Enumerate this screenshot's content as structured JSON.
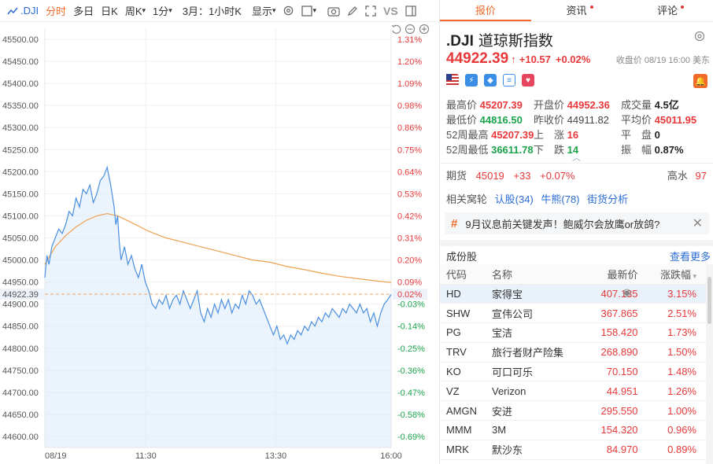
{
  "toolbar": {
    "symbol": ".DJI",
    "items": [
      "分时",
      "多日",
      "日K",
      "周K",
      "1分",
      "3月：1小时K",
      "显示"
    ],
    "vs": "VS"
  },
  "chart_data": {
    "type": "line",
    "y_labels": [
      "45500.00",
      "45450.00",
      "45400.00",
      "45350.00",
      "45300.00",
      "45250.00",
      "45200.00",
      "45150.00",
      "45100.00",
      "45050.00",
      "45000.00",
      "44950.00",
      "44900.00",
      "44850.00",
      "44800.00",
      "44750.00",
      "44700.00",
      "44650.00",
      "44600.00"
    ],
    "y_values": [
      45500,
      45450,
      45400,
      45350,
      45300,
      45250,
      45200,
      45150,
      45100,
      45050,
      45000,
      44950,
      44900,
      44850,
      44800,
      44750,
      44700,
      44650,
      44600
    ],
    "pct_labels": [
      "1.31%",
      "1.20%",
      "1.09%",
      "0.98%",
      "0.86%",
      "0.75%",
      "0.64%",
      "0.53%",
      "0.42%",
      "0.31%",
      "0.20%",
      "0.09%",
      "-0.03%",
      "-0.14%",
      "-0.25%",
      "-0.36%",
      "-0.47%",
      "-0.58%",
      "-0.69%"
    ],
    "pct_marker": "0.02%",
    "current": 44922.39,
    "current_label": "44922.39",
    "prev_close": 44911.82,
    "ylim": [
      44575,
      45525
    ],
    "x_labels": [
      "08/19",
      "11:30",
      "13:30",
      "16:00"
    ],
    "x_positions": [
      0,
      0.2917,
      0.6667,
      1.0
    ],
    "price_series": [
      [
        0,
        44960
      ],
      [
        0.006,
        45010
      ],
      [
        0.012,
        44990
      ],
      [
        0.02,
        45030
      ],
      [
        0.03,
        45050
      ],
      [
        0.04,
        45070
      ],
      [
        0.05,
        45060
      ],
      [
        0.06,
        45080
      ],
      [
        0.07,
        45110
      ],
      [
        0.08,
        45100
      ],
      [
        0.09,
        45140
      ],
      [
        0.1,
        45120
      ],
      [
        0.11,
        45160
      ],
      [
        0.12,
        45150
      ],
      [
        0.13,
        45170
      ],
      [
        0.14,
        45130
      ],
      [
        0.15,
        45150
      ],
      [
        0.16,
        45180
      ],
      [
        0.17,
        45190
      ],
      [
        0.18,
        45210
      ],
      [
        0.19,
        45170
      ],
      [
        0.2,
        45120
      ],
      [
        0.205,
        45080
      ],
      [
        0.21,
        45100
      ],
      [
        0.215,
        45040
      ],
      [
        0.22,
        45000
      ],
      [
        0.23,
        45030
      ],
      [
        0.24,
        44990
      ],
      [
        0.25,
        45010
      ],
      [
        0.26,
        44980
      ],
      [
        0.27,
        44960
      ],
      [
        0.28,
        44990
      ],
      [
        0.29,
        44950
      ],
      [
        0.3,
        44930
      ],
      [
        0.31,
        44900
      ],
      [
        0.32,
        44890
      ],
      [
        0.33,
        44910
      ],
      [
        0.34,
        44900
      ],
      [
        0.35,
        44920
      ],
      [
        0.36,
        44890
      ],
      [
        0.37,
        44910
      ],
      [
        0.38,
        44920
      ],
      [
        0.39,
        44900
      ],
      [
        0.4,
        44930
      ],
      [
        0.41,
        44910
      ],
      [
        0.42,
        44890
      ],
      [
        0.43,
        44910
      ],
      [
        0.44,
        44930
      ],
      [
        0.45,
        44880
      ],
      [
        0.46,
        44860
      ],
      [
        0.47,
        44890
      ],
      [
        0.48,
        44870
      ],
      [
        0.49,
        44900
      ],
      [
        0.5,
        44880
      ],
      [
        0.51,
        44910
      ],
      [
        0.52,
        44890
      ],
      [
        0.53,
        44910
      ],
      [
        0.54,
        44880
      ],
      [
        0.55,
        44900
      ],
      [
        0.56,
        44890
      ],
      [
        0.57,
        44920
      ],
      [
        0.58,
        44900
      ],
      [
        0.59,
        44930
      ],
      [
        0.6,
        44920
      ],
      [
        0.61,
        44900
      ],
      [
        0.62,
        44910
      ],
      [
        0.63,
        44890
      ],
      [
        0.64,
        44870
      ],
      [
        0.65,
        44850
      ],
      [
        0.66,
        44830
      ],
      [
        0.67,
        44850
      ],
      [
        0.68,
        44820
      ],
      [
        0.69,
        44830
      ],
      [
        0.7,
        44810
      ],
      [
        0.71,
        44830
      ],
      [
        0.72,
        44820
      ],
      [
        0.73,
        44840
      ],
      [
        0.74,
        44830
      ],
      [
        0.75,
        44850
      ],
      [
        0.76,
        44840
      ],
      [
        0.77,
        44860
      ],
      [
        0.78,
        44850
      ],
      [
        0.79,
        44870
      ],
      [
        0.8,
        44860
      ],
      [
        0.81,
        44880
      ],
      [
        0.82,
        44870
      ],
      [
        0.83,
        44890
      ],
      [
        0.84,
        44880
      ],
      [
        0.85,
        44870
      ],
      [
        0.86,
        44890
      ],
      [
        0.87,
        44880
      ],
      [
        0.88,
        44900
      ],
      [
        0.89,
        44890
      ],
      [
        0.9,
        44880
      ],
      [
        0.91,
        44900
      ],
      [
        0.92,
        44880
      ],
      [
        0.93,
        44890
      ],
      [
        0.94,
        44860
      ],
      [
        0.95,
        44880
      ],
      [
        0.96,
        44850
      ],
      [
        0.97,
        44880
      ],
      [
        0.98,
        44900
      ],
      [
        0.99,
        44910
      ],
      [
        1.0,
        44922
      ]
    ],
    "avg_series": [
      [
        0,
        44990
      ],
      [
        0.03,
        45030
      ],
      [
        0.06,
        45055
      ],
      [
        0.09,
        45075
      ],
      [
        0.12,
        45090
      ],
      [
        0.15,
        45100
      ],
      [
        0.18,
        45105
      ],
      [
        0.21,
        45100
      ],
      [
        0.25,
        45085
      ],
      [
        0.3,
        45065
      ],
      [
        0.35,
        45050
      ],
      [
        0.4,
        45040
      ],
      [
        0.45,
        45030
      ],
      [
        0.5,
        45020
      ],
      [
        0.55,
        45010
      ],
      [
        0.6,
        45000
      ],
      [
        0.65,
        44995
      ],
      [
        0.7,
        44985
      ],
      [
        0.75,
        44978
      ],
      [
        0.8,
        44970
      ],
      [
        0.85,
        44963
      ],
      [
        0.9,
        44958
      ],
      [
        0.95,
        44953
      ],
      [
        1.0,
        44949
      ]
    ],
    "grid": true,
    "colors": {
      "price": "#4a8fe0",
      "avg": "#f0a050",
      "fill": "#dbe9fb",
      "current": "#f3a35f",
      "up": "#e8393a",
      "down": "#1aa34a"
    }
  },
  "tabs": [
    {
      "label": "报价",
      "active": true,
      "dot": false
    },
    {
      "label": "资讯",
      "active": false,
      "dot": true
    },
    {
      "label": "评论",
      "active": false,
      "dot": true
    }
  ],
  "quote": {
    "symbol": ".DJI",
    "name": "道琼斯指数",
    "price": "44922.39",
    "arrow": "↑",
    "change": "+10.57",
    "change_pct": "+0.02%",
    "close_time": "收盘价 08/19 16:00 美东"
  },
  "stats": {
    "high_l": "最高价",
    "high_v": "45207.39",
    "open_l": "开盘价",
    "open_v": "44952.36",
    "vol_l": "成交量",
    "vol_v": "4.5亿",
    "low_l": "最低价",
    "low_v": "44816.50",
    "prev_l": "昨收价",
    "prev_v": "44911.82",
    "avg_l": "平均价",
    "avg_v": "45011.95",
    "w52h_l": "52周最高",
    "w52h_v": "45207.39",
    "up_l": "上　涨",
    "up_v": "16",
    "flat_l": "平　盘",
    "flat_v": "0",
    "w52l_l": "52周最低",
    "w52l_v": "36611.78",
    "down_l": "下　跌",
    "down_v": "14",
    "amp_l": "振　幅",
    "amp_v": "0.87%"
  },
  "futures": {
    "label": "期货",
    "price": "45019",
    "change": "+33",
    "pct": "+0.07%",
    "hs_label": "高水",
    "hs_value": "97"
  },
  "related": {
    "label": "相关窝轮",
    "links": [
      "认股(34)",
      "牛熊(78)",
      "街货分析"
    ]
  },
  "news": {
    "text": "9月议息前关键发声！鲍威尔会放鹰or放鸽?"
  },
  "constituents": {
    "title": "成份股",
    "more": "查看更多",
    "headers": [
      "代码",
      "名称",
      "最新价",
      "涨跌幅"
    ],
    "rows": [
      {
        "code": "HD",
        "name": "家得宝",
        "price": "407.135",
        "chg": "3.15%"
      },
      {
        "code": "SHW",
        "name": "宣伟公司",
        "price": "367.865",
        "chg": "2.51%"
      },
      {
        "code": "PG",
        "name": "宝洁",
        "price": "158.420",
        "chg": "1.73%"
      },
      {
        "code": "TRV",
        "name": "旅行者财产险集",
        "price": "268.890",
        "chg": "1.50%"
      },
      {
        "code": "KO",
        "name": "可口可乐",
        "price": "70.150",
        "chg": "1.48%"
      },
      {
        "code": "VZ",
        "name": "Verizon",
        "price": "44.951",
        "chg": "1.26%"
      },
      {
        "code": "AMGN",
        "name": "安进",
        "price": "295.550",
        "chg": "1.00%"
      },
      {
        "code": "MMM",
        "name": "3M",
        "price": "154.320",
        "chg": "0.96%"
      },
      {
        "code": "MRK",
        "name": "默沙东",
        "price": "84.970",
        "chg": "0.89%"
      }
    ]
  }
}
